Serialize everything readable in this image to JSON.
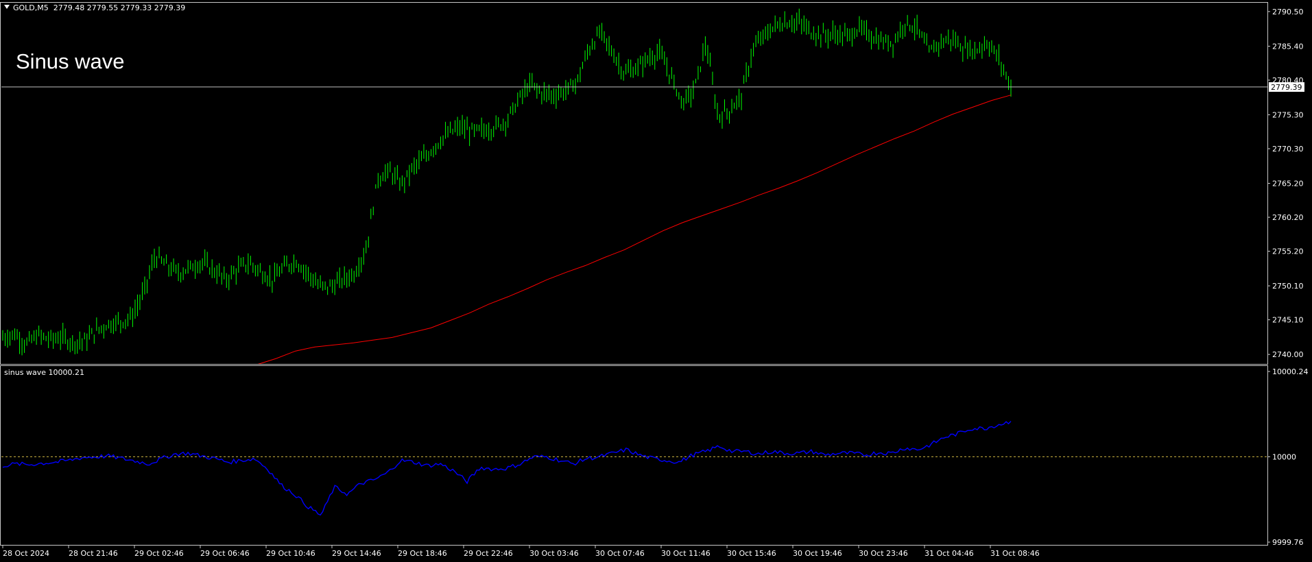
{
  "header": {
    "symbol": "GOLD,M5",
    "ohlc": "2779.48 2779.55 2779.33 2779.39",
    "annotation": "Sinus wave"
  },
  "colors": {
    "background": "#000000",
    "frame": "#c8c8c8",
    "price": "#00ff00",
    "ma": "#ff0000",
    "indicator": "#0000ff",
    "level_line": "#c8b040",
    "bid_line": "#c0c0c0"
  },
  "indicator": {
    "label": "sinus wave 10000.21"
  },
  "chart_data": [
    {
      "type": "line",
      "name": "main",
      "title": "",
      "x": [
        "28 Oct 2024",
        "28 Oct 21:46",
        "29 Oct 02:46",
        "29 Oct 06:46",
        "29 Oct 10:46",
        "29 Oct 14:46",
        "29 Oct 18:46",
        "29 Oct 22:46",
        "30 Oct 03:46",
        "30 Oct 07:46",
        "30 Oct 11:46",
        "30 Oct 15:46",
        "30 Oct 19:46",
        "30 Oct 23:46",
        "31 Oct 04:46",
        "31 Oct 08:46"
      ],
      "yticks": [
        "2790.50",
        "2785.40",
        "2780.40",
        "2775.30",
        "2770.30",
        "2765.20",
        "2760.20",
        "2755.20",
        "2750.10",
        "2745.10",
        "2740.00"
      ],
      "ylim": [
        2738.6,
        2791.8
      ],
      "current_price": "2779.39",
      "series": [
        {
          "name": "",
          "kind": "price-bars",
          "values": [
            2742.5,
            2743.0,
            2741.5,
            2742.8,
            2742.2,
            2742.5,
            2741.8,
            2742.0,
            2743.5,
            2744.5,
            2744.8,
            2745.5,
            2749.0,
            2754.5,
            2753.0,
            2752.0,
            2752.8,
            2753.6,
            2752.4,
            2751.0,
            2752.5,
            2753.5,
            2752.2,
            2751.0,
            2752.8,
            2753.8,
            2752.0,
            2750.0,
            2750.0,
            2751.0,
            2752.0,
            2755.5,
            2766.0,
            2767.0,
            2765.0,
            2767.5,
            2769.0,
            2771.0,
            2772.5,
            2773.5,
            2772.8,
            2773.0,
            2773.5,
            2774.5,
            2777.5,
            2779.8,
            2778.5,
            2778.2,
            2778.8,
            2780.2,
            2785.0,
            2787.5,
            2784.5,
            2781.5,
            2782.0,
            2783.5,
            2784.5,
            2781.0,
            2777.0,
            2779.0,
            2786.0,
            2775.0,
            2776.0,
            2778.0,
            2785.0,
            2787.0,
            2788.5,
            2789.0,
            2788.8,
            2787.5,
            2787.0,
            2787.2,
            2786.8,
            2788.0,
            2787.0,
            2786.0,
            2786.0,
            2789.0,
            2788.0,
            2784.5,
            2786.0,
            2786.5,
            2785.0,
            2784.8,
            2786.0,
            2783.5,
            2779.4
          ]
        },
        {
          "name": "",
          "kind": "moving-average",
          "values": [
            2737.0,
            2737.6,
            2738.5,
            2739.4,
            2740.5,
            2741.1,
            2741.4,
            2741.7,
            2742.1,
            2742.5,
            2743.2,
            2743.9,
            2745.0,
            2746.1,
            2747.4,
            2748.5,
            2749.7,
            2751.0,
            2752.1,
            2753.1,
            2754.3,
            2755.4,
            2756.8,
            2758.2,
            2759.4,
            2760.4,
            2761.4,
            2762.4,
            2763.5,
            2764.5,
            2765.6,
            2766.8,
            2768.1,
            2769.4,
            2770.6,
            2771.8,
            2772.9,
            2774.2,
            2775.4,
            2776.4,
            2777.4,
            2778.2
          ]
        }
      ]
    },
    {
      "type": "line",
      "name": "sinus wave",
      "title": "",
      "yticks": [
        "10000.24",
        "10000",
        "9999.76"
      ],
      "ylim": [
        9999.76,
        10000.24
      ],
      "level": 10000,
      "series": [
        {
          "name": "",
          "values": [
            9999.975,
            9999.98,
            9999.978,
            9999.982,
            9999.985,
            9999.99,
            9999.998,
            10000.0,
            10000.002,
            9999.995,
            9999.988,
            9999.98,
            9999.995,
            10000.008,
            10000.01,
            10000.002,
            9999.995,
            9999.985,
            9999.99,
            9999.995,
            9999.965,
            9999.92,
            9999.895,
            9999.86,
            9999.835,
            9999.915,
            9999.895,
            9999.925,
            9999.935,
            9999.955,
            9999.99,
            9999.985,
            9999.975,
            9999.98,
            9999.96,
            9999.93,
            9999.97,
            9999.965,
            9999.968,
            9999.98,
            10000.0,
            10000.0,
            9999.99,
            9999.98,
            9999.995,
            10000.0,
            10000.01,
            10000.02,
            10000.005,
            9999.995,
            9999.99,
            9999.985,
            10000.005,
            10000.015,
            10000.03,
            10000.015,
            10000.015,
            10000.008,
            10000.015,
            10000.01,
            10000.01,
            10000.015,
            10000.005,
            10000.01,
            10000.01,
            10000.005,
            10000.012,
            10000.01,
            10000.025,
            10000.02,
            10000.035,
            10000.055,
            10000.065,
            10000.08,
            10000.08,
            10000.09,
            10000.1
          ]
        }
      ]
    }
  ]
}
